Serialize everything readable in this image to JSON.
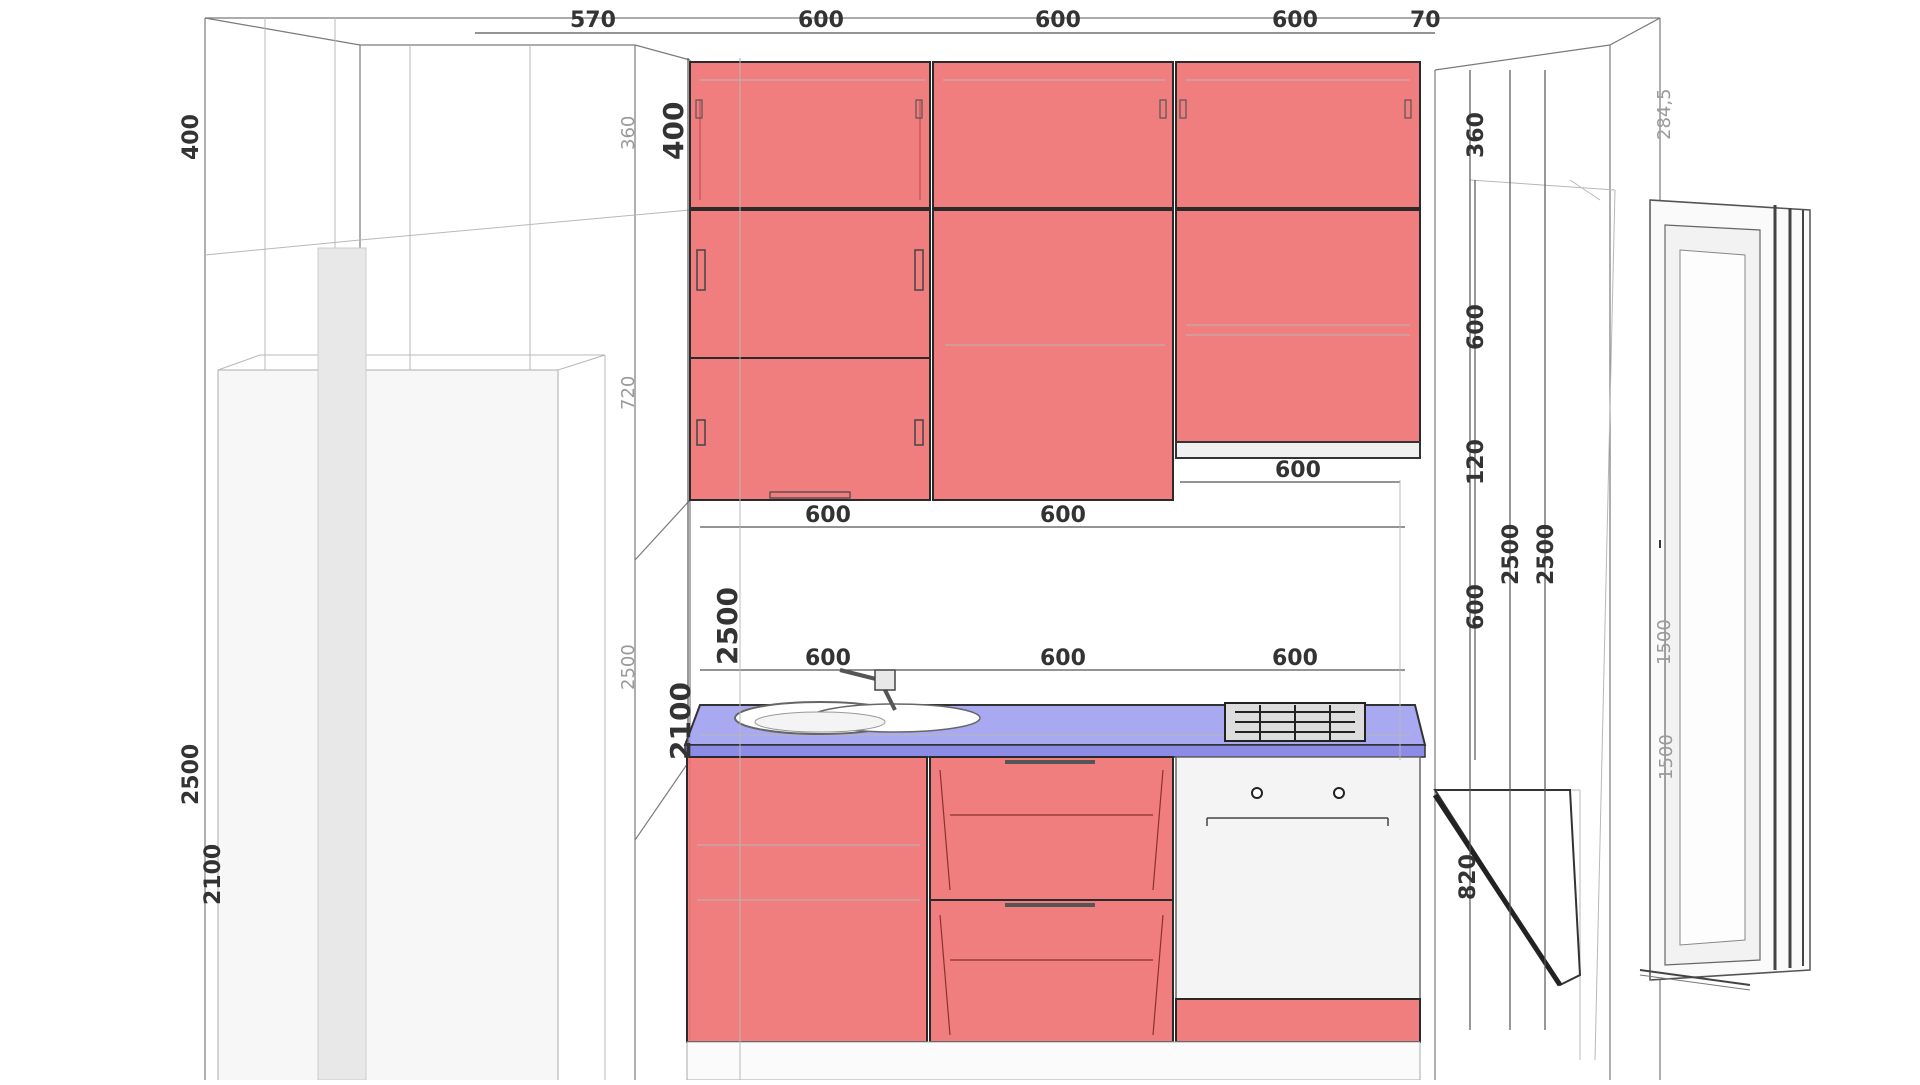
{
  "colors": {
    "cabinet_fill": "#f07070",
    "cabinet_edge": "#2a2a2a",
    "countertop_fill": "#9a9af0",
    "background": "#ffffff",
    "oven_fill": "#f4f4f4"
  },
  "dimensions": {
    "top_570": "570",
    "top_600_a": "600",
    "top_600_b": "600",
    "top_600_c": "600",
    "top_70": "70",
    "left_400": "400",
    "left_2500": "2500",
    "left_2100": "2100",
    "upper_400": "400",
    "upper_360": "360",
    "upper_600_right": "600",
    "hood_120": "120",
    "hood_width_600": "600",
    "wall_600_a": "600",
    "wall_600_b": "600",
    "mid_2500": "2500",
    "mid_2100": "2100",
    "counter_600_a": "600",
    "counter_600_b": "600",
    "counter_600_c": "600",
    "right_600_gap": "600",
    "right_2500_a": "2500",
    "right_2500_b": "2500",
    "base_820": "820",
    "window_1500": "1500",
    "window_1500_b": "1500",
    "corner_284": "284,5",
    "faint_360": "360",
    "faint_720": "720",
    "faint_2500": "2500"
  }
}
